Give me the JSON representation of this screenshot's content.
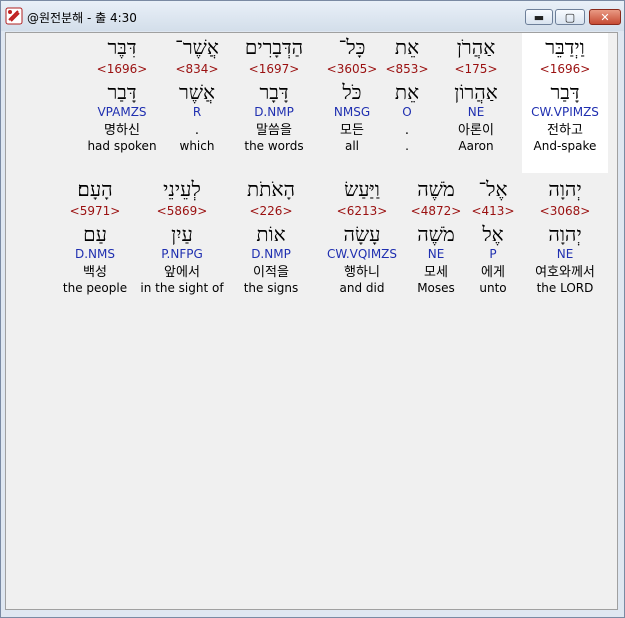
{
  "window": {
    "title": "@원전분해 - 출 4:30"
  },
  "controls": {
    "minimize": "▬",
    "maximize": "▢",
    "close": "✕"
  },
  "rows": [
    {
      "words": [
        {
          "hebrew": "וַיְדַבֵּר",
          "strong": "<1696>",
          "lemma": "דָּבַר",
          "parse": "CW.VPIMZS",
          "korean": "전하고",
          "english": "And-spake",
          "highlight": true
        },
        {
          "hebrew": "אַהֲרֹן",
          "strong": "<175>",
          "lemma": "אַהֲרוֹן",
          "parse": "NE",
          "korean": "아론이",
          "english": "Aaron",
          "highlight": false
        },
        {
          "hebrew": "אֵת",
          "strong": "<853>",
          "lemma": "אֵת",
          "parse": "O",
          "korean": ".",
          "english": ".",
          "highlight": false
        },
        {
          "hebrew": "כָּל־",
          "strong": "<3605>",
          "lemma": "כֹּל",
          "parse": "NMSG",
          "korean": "모든",
          "english": "all",
          "highlight": false
        },
        {
          "hebrew": "הַדְּבָרִים",
          "strong": "<1697>",
          "lemma": "דָּבָר",
          "parse": "D.NMP",
          "korean": "말씀을",
          "english": "the words",
          "highlight": false
        },
        {
          "hebrew": "אֲשֶׁר־",
          "strong": "<834>",
          "lemma": "אֲשֶׁר",
          "parse": "R",
          "korean": ".",
          "english": "which",
          "highlight": false
        },
        {
          "hebrew": "דִּבֶּר",
          "strong": "<1696>",
          "lemma": "דָּבַר",
          "parse": "VPAMZS",
          "korean": "명하신",
          "english": "had spoken",
          "highlight": false
        }
      ]
    },
    {
      "words": [
        {
          "hebrew": "יְהוָה",
          "strong": "<3068>",
          "lemma": "יְהוָה",
          "parse": "NE",
          "korean": "여호와께서",
          "english": "the LORD",
          "highlight": false
        },
        {
          "hebrew": "אֶל־",
          "strong": "<413>",
          "lemma": "אֶל",
          "parse": "P",
          "korean": "에게",
          "english": "unto",
          "highlight": false
        },
        {
          "hebrew": "מֹשֶׁה",
          "strong": "<4872>",
          "lemma": "מֹשֶׁה",
          "parse": "NE",
          "korean": "모세",
          "english": "Moses",
          "highlight": false
        },
        {
          "hebrew": "וַיַּעַשׂ",
          "strong": "<6213>",
          "lemma": "עָשָׂה",
          "parse": "CW.VQIMZS",
          "korean": "행하니",
          "english": "and did",
          "highlight": false
        },
        {
          "hebrew": "הָאֹתֹת",
          "strong": "<226>",
          "lemma": "אוֹת",
          "parse": "D.NMP",
          "korean": "이적을",
          "english": "the signs",
          "highlight": false
        },
        {
          "hebrew": "לְעֵינֵי",
          "strong": "<5869>",
          "lemma": "עַיִן",
          "parse": "P.NFPG",
          "korean": "앞에서",
          "english": "in the sight of",
          "highlight": false
        },
        {
          "hebrew": "הָעָם׃",
          "strong": "<5971>",
          "lemma": "עַם",
          "parse": "D.NMS",
          "korean": "백성",
          "english": "the people",
          "highlight": false
        }
      ]
    }
  ],
  "colors": {
    "strong": "#9a1010",
    "parse": "#1f2fb0",
    "highlight": "#ffffff",
    "background": "#f0f0f0"
  }
}
